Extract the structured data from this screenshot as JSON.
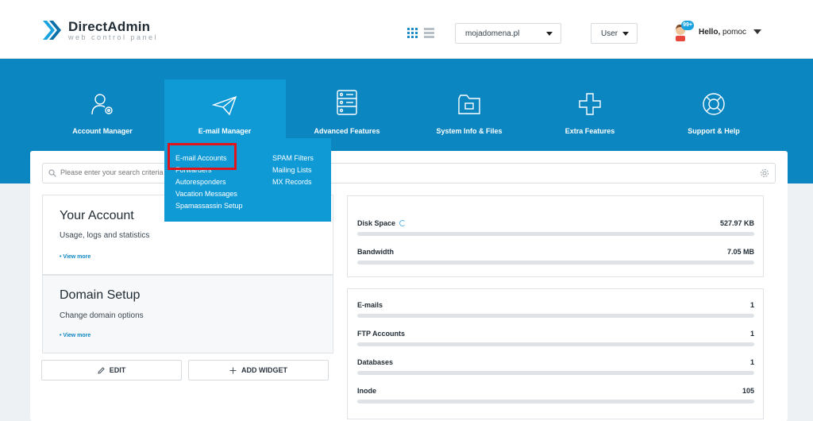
{
  "header": {
    "brand": "DirectAdmin",
    "tagline": "web control panel",
    "domain_select": "mojadomena.pl",
    "role_select": "User",
    "notification_badge": "99+",
    "hello_prefix": "Hello,",
    "username": "pomoc"
  },
  "nav": {
    "items": [
      {
        "label": "Account Manager",
        "icon": "user-gear-icon"
      },
      {
        "label": "E-mail Manager",
        "icon": "paper-plane-icon"
      },
      {
        "label": "Advanced Features",
        "icon": "server-icon"
      },
      {
        "label": "System Info & Files",
        "icon": "folder-icon"
      },
      {
        "label": "Extra Features",
        "icon": "plus-icon"
      },
      {
        "label": "Support & Help",
        "icon": "lifebuoy-icon"
      }
    ],
    "active": "E-mail Manager"
  },
  "email_menu": {
    "left": [
      "E-mail Accounts",
      "Forwarders",
      "Autoresponders",
      "Vacation Messages",
      "Spamassassin Setup"
    ],
    "right": [
      "SPAM Filters",
      "Mailing Lists",
      "MX Records"
    ],
    "highlighted": "E-mail Accounts"
  },
  "search": {
    "placeholder": "Please enter your search criteria"
  },
  "widgets": {
    "your_account": {
      "title": "Your Account",
      "subtitle": "Usage, logs and statistics",
      "more": "• View more"
    },
    "domain_setup": {
      "title": "Domain Setup",
      "subtitle": "Change domain options",
      "more": "• View more"
    }
  },
  "buttons": {
    "edit": "EDIT",
    "add_widget": "ADD WIDGET"
  },
  "usage": [
    {
      "label": "Disk Space",
      "value": "527.97 KB",
      "fill": 0
    },
    {
      "label": "Bandwidth",
      "value": "7.05 MB",
      "fill": 0
    }
  ],
  "counts": [
    {
      "label": "E-mails",
      "value": "1",
      "fill": 0
    },
    {
      "label": "FTP Accounts",
      "value": "1",
      "fill": 0
    },
    {
      "label": "Databases",
      "value": "1",
      "fill": 0
    },
    {
      "label": "Inode",
      "value": "105",
      "fill": 0
    }
  ],
  "colors": {
    "nav_blue": "#0b86c1",
    "active_blue": "#0f9ad6",
    "highlight_red": "#e0141b"
  }
}
